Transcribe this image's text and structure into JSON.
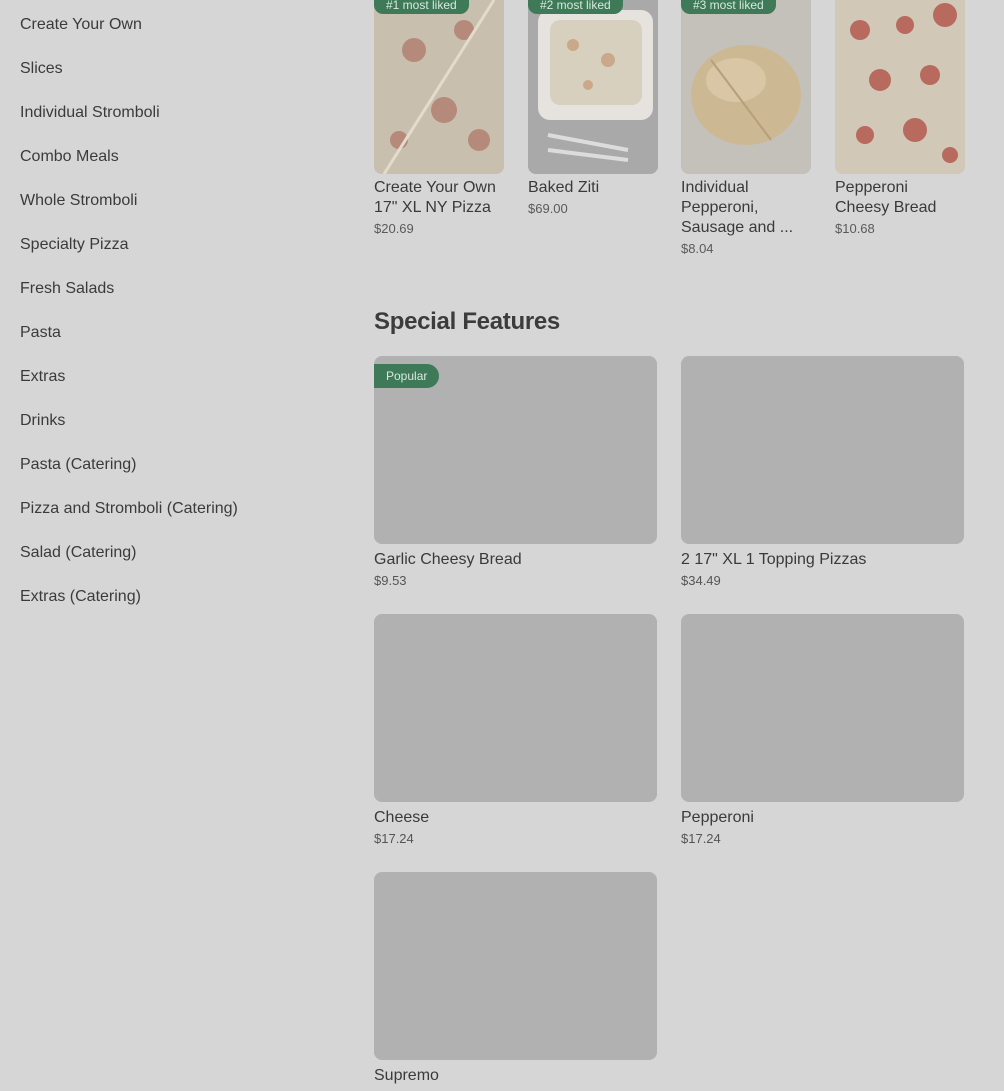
{
  "sidebar": {
    "items": [
      {
        "label": "Create Your Own"
      },
      {
        "label": "Slices"
      },
      {
        "label": "Individual Stromboli"
      },
      {
        "label": "Combo Meals"
      },
      {
        "label": "Whole Stromboli"
      },
      {
        "label": "Specialty Pizza"
      },
      {
        "label": "Fresh Salads"
      },
      {
        "label": "Pasta"
      },
      {
        "label": "Extras"
      },
      {
        "label": "Drinks"
      },
      {
        "label": "Pasta (Catering)"
      },
      {
        "label": "Pizza and Stromboli (Catering)"
      },
      {
        "label": "Salad (Catering)"
      },
      {
        "label": "Extras (Catering)"
      }
    ]
  },
  "most_liked": [
    {
      "badge": "#1 most liked",
      "name": "Create Your Own 17\" XL NY Pizza",
      "price": "$20.69"
    },
    {
      "badge": "#2 most liked",
      "name": "Baked Ziti",
      "price": "$69.00"
    },
    {
      "badge": "#3 most liked",
      "name": "Individual Pepperoni, Sausage and ...",
      "price": "$8.04"
    },
    {
      "badge": "",
      "name": "Pepperoni Cheesy Bread",
      "price": "$10.68"
    }
  ],
  "special_features": {
    "title": "Special Features",
    "items": [
      {
        "badge": "Popular",
        "name": "Garlic Cheesy Bread",
        "price": "$9.53"
      },
      {
        "badge": "",
        "name": "2 17\" XL 1 Topping Pizzas",
        "price": "$34.49"
      },
      {
        "badge": "",
        "name": "Cheese",
        "price": "$17.24"
      },
      {
        "badge": "",
        "name": "Pepperoni",
        "price": "$17.24"
      },
      {
        "badge": "",
        "name": "Supremo",
        "price": ""
      }
    ]
  },
  "colors": {
    "background": "#d6d6d6",
    "badge": "#3e7a58",
    "placeholder": "#b1b1b1"
  }
}
